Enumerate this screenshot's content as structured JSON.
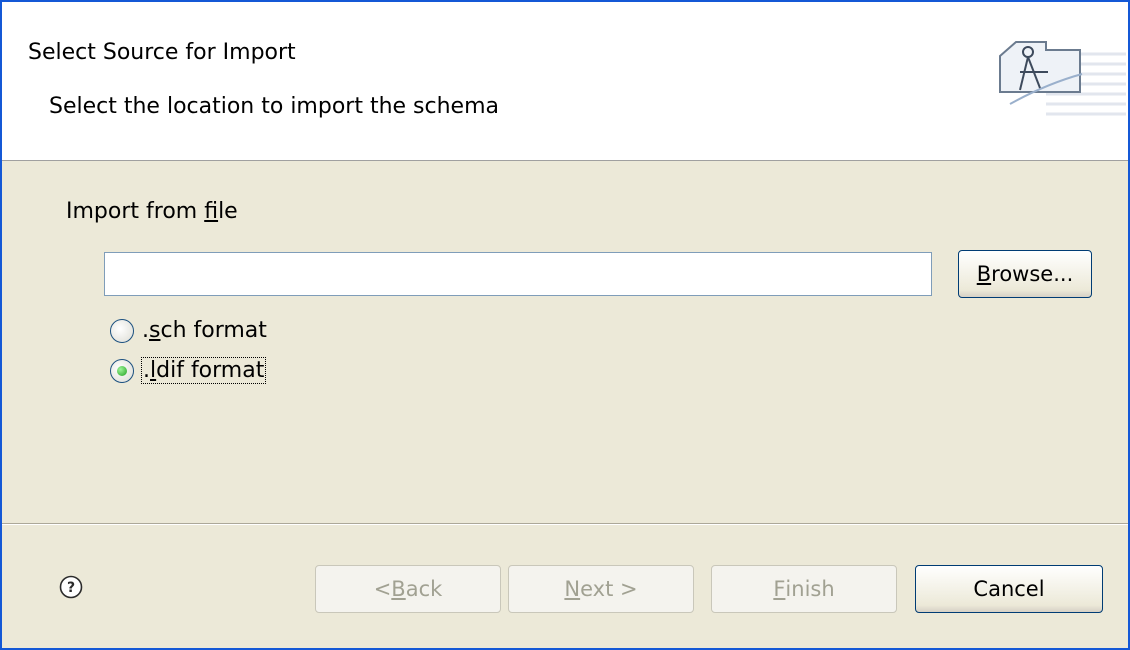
{
  "header": {
    "title": "Select Source for Import",
    "description": "Select the location to import the schema",
    "icon": "wizard-banner-icon"
  },
  "body": {
    "import_label_pre": "Import from ",
    "import_label_mnemonic": "f",
    "import_label_post": "ile",
    "file_input": {
      "value": "",
      "placeholder": ""
    },
    "browse_button": {
      "mnemonic": "B",
      "rest": "rowse..."
    },
    "radios": [
      {
        "pre": ".",
        "mnemonic": "s",
        "post": "ch format",
        "checked": false
      },
      {
        "pre": ".",
        "mnemonic": "l",
        "post": "dif format",
        "checked": true
      }
    ]
  },
  "footer": {
    "help_icon": "help-icon",
    "back": {
      "pre": "< ",
      "mnemonic": "B",
      "post": "ack",
      "enabled": false
    },
    "next": {
      "pre": "",
      "mnemonic": "N",
      "post": "ext >",
      "enabled": false
    },
    "finish": {
      "pre": "",
      "mnemonic": "F",
      "post": "inish",
      "enabled": false
    },
    "cancel": {
      "label": "Cancel",
      "enabled": true
    }
  },
  "colors": {
    "window_border": "#1458d6",
    "dialog_bg": "#ece9d8",
    "radio_checked": "#21a121"
  }
}
